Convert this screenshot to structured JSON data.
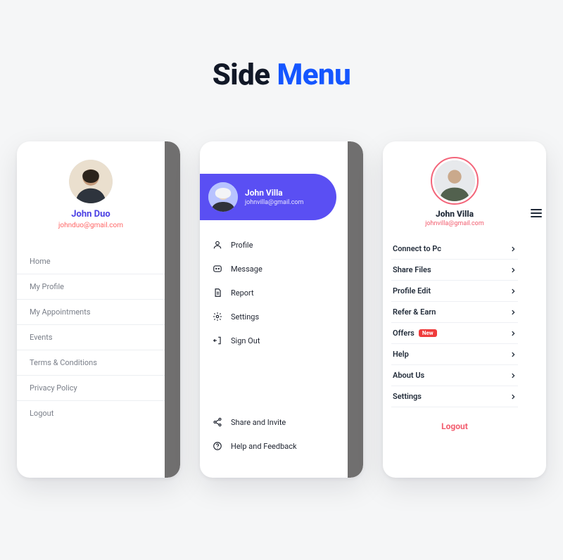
{
  "title": {
    "part1": "Side ",
    "part2": "Menu"
  },
  "phone1": {
    "name": "John Duo",
    "email": "johnduo@gmail.com",
    "items": [
      "Home",
      "My Profile",
      "My Appointments",
      "Events",
      "Terms & Conditions",
      "Privacy Policy",
      "Logout"
    ]
  },
  "phone2": {
    "name": "John Villa",
    "email": "johnvilla@gmail.com",
    "items": [
      "Profile",
      "Message",
      "Report",
      "Settings",
      "Sign Out"
    ],
    "bottom": [
      "Share and Invite",
      "Help and Feedback"
    ]
  },
  "phone3": {
    "name": "John Villa",
    "email": "johnvilla@gmail.com",
    "items": [
      {
        "label": "Connect to Pc",
        "badge": null
      },
      {
        "label": "Share Files",
        "badge": null
      },
      {
        "label": "Profile Edit",
        "badge": null
      },
      {
        "label": "Refer & Earn",
        "badge": null
      },
      {
        "label": "Offers",
        "badge": "New"
      },
      {
        "label": "Help",
        "badge": null
      },
      {
        "label": "About Us",
        "badge": null
      },
      {
        "label": "Settings",
        "badge": null
      }
    ],
    "logout": "Logout"
  }
}
